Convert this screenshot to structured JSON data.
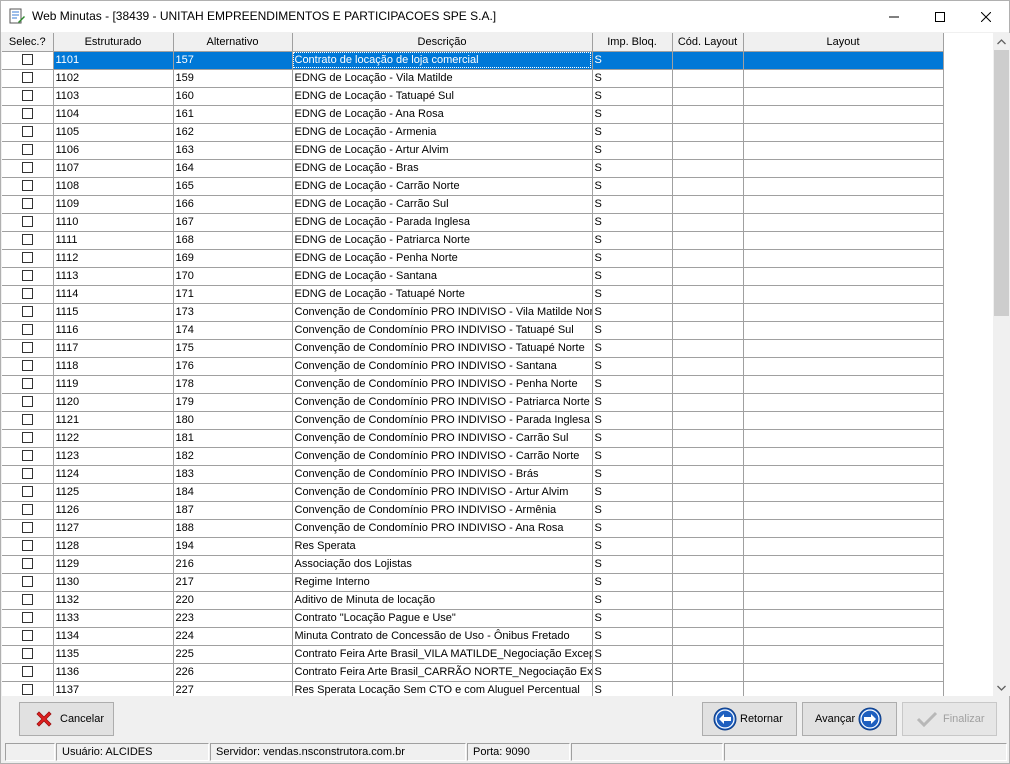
{
  "window": {
    "title": "Web Minutas - [38439 - UNITAH EMPREENDIMENTOS E PARTICIPACOES SPE S.A.]"
  },
  "grid": {
    "columns": [
      "Selec.?",
      "Estruturado",
      "Alternativo",
      "Descrição",
      "Imp. Bloq.",
      "Cód. Layout",
      "Layout"
    ],
    "rows": [
      {
        "estruturado": "1101",
        "alternativo": "157",
        "descricao": "Contrato de locação de loja comercial",
        "imp_bloq": "S",
        "cod_layout": "",
        "layout": ""
      },
      {
        "estruturado": "1102",
        "alternativo": "159",
        "descricao": "EDNG de Locação - Vila Matilde",
        "imp_bloq": "S",
        "cod_layout": "",
        "layout": ""
      },
      {
        "estruturado": "1103",
        "alternativo": "160",
        "descricao": "EDNG de Locação - Tatuapé Sul",
        "imp_bloq": "S",
        "cod_layout": "",
        "layout": ""
      },
      {
        "estruturado": "1104",
        "alternativo": "161",
        "descricao": "EDNG de Locação - Ana Rosa",
        "imp_bloq": "S",
        "cod_layout": "",
        "layout": ""
      },
      {
        "estruturado": "1105",
        "alternativo": "162",
        "descricao": "EDNG de Locação - Armenia",
        "imp_bloq": "S",
        "cod_layout": "",
        "layout": ""
      },
      {
        "estruturado": "1106",
        "alternativo": "163",
        "descricao": "EDNG de Locação - Artur Alvim",
        "imp_bloq": "S",
        "cod_layout": "",
        "layout": ""
      },
      {
        "estruturado": "1107",
        "alternativo": "164",
        "descricao": "EDNG de Locação - Bras",
        "imp_bloq": "S",
        "cod_layout": "",
        "layout": ""
      },
      {
        "estruturado": "1108",
        "alternativo": "165",
        "descricao": "EDNG de Locação - Carrão Norte",
        "imp_bloq": "S",
        "cod_layout": "",
        "layout": ""
      },
      {
        "estruturado": "1109",
        "alternativo": "166",
        "descricao": "EDNG de Locação - Carrão Sul",
        "imp_bloq": "S",
        "cod_layout": "",
        "layout": ""
      },
      {
        "estruturado": "1110",
        "alternativo": "167",
        "descricao": "EDNG de Locação - Parada Inglesa",
        "imp_bloq": "S",
        "cod_layout": "",
        "layout": ""
      },
      {
        "estruturado": "1111",
        "alternativo": "168",
        "descricao": "EDNG de Locação - Patriarca Norte",
        "imp_bloq": "S",
        "cod_layout": "",
        "layout": ""
      },
      {
        "estruturado": "1112",
        "alternativo": "169",
        "descricao": "EDNG de Locação - Penha Norte",
        "imp_bloq": "S",
        "cod_layout": "",
        "layout": ""
      },
      {
        "estruturado": "1113",
        "alternativo": "170",
        "descricao": "EDNG de Locação - Santana",
        "imp_bloq": "S",
        "cod_layout": "",
        "layout": ""
      },
      {
        "estruturado": "1114",
        "alternativo": "171",
        "descricao": "EDNG de Locação - Tatuapé Norte",
        "imp_bloq": "S",
        "cod_layout": "",
        "layout": ""
      },
      {
        "estruturado": "1115",
        "alternativo": "173",
        "descricao": "Convenção de Condomínio PRO INDIVISO - Vila Matilde Norte",
        "imp_bloq": "S",
        "cod_layout": "",
        "layout": ""
      },
      {
        "estruturado": "1116",
        "alternativo": "174",
        "descricao": "Convenção de Condomínio PRO INDIVISO - Tatuapé Sul",
        "imp_bloq": "S",
        "cod_layout": "",
        "layout": ""
      },
      {
        "estruturado": "1117",
        "alternativo": "175",
        "descricao": "Convenção de Condomínio PRO INDIVISO - Tatuapé Norte",
        "imp_bloq": "S",
        "cod_layout": "",
        "layout": ""
      },
      {
        "estruturado": "1118",
        "alternativo": "176",
        "descricao": "Convenção de Condomínio PRO INDIVISO - Santana",
        "imp_bloq": "S",
        "cod_layout": "",
        "layout": ""
      },
      {
        "estruturado": "1119",
        "alternativo": "178",
        "descricao": "Convenção de Condomínio PRO INDIVISO - Penha Norte",
        "imp_bloq": "S",
        "cod_layout": "",
        "layout": ""
      },
      {
        "estruturado": "1120",
        "alternativo": "179",
        "descricao": "Convenção de Condomínio PRO INDIVISO - Patriarca Norte",
        "imp_bloq": "S",
        "cod_layout": "",
        "layout": ""
      },
      {
        "estruturado": "1121",
        "alternativo": "180",
        "descricao": "Convenção de Condomínio PRO INDIVISO - Parada Inglesa",
        "imp_bloq": "S",
        "cod_layout": "",
        "layout": ""
      },
      {
        "estruturado": "1122",
        "alternativo": "181",
        "descricao": "Convenção de Condomínio PRO INDIVISO - Carrão Sul",
        "imp_bloq": "S",
        "cod_layout": "",
        "layout": ""
      },
      {
        "estruturado": "1123",
        "alternativo": "182",
        "descricao": "Convenção de Condomínio PRO INDIVISO - Carrão Norte",
        "imp_bloq": "S",
        "cod_layout": "",
        "layout": ""
      },
      {
        "estruturado": "1124",
        "alternativo": "183",
        "descricao": "Convenção de Condomínio PRO INDIVISO - Brás",
        "imp_bloq": "S",
        "cod_layout": "",
        "layout": ""
      },
      {
        "estruturado": "1125",
        "alternativo": "184",
        "descricao": "Convenção de Condomínio PRO INDIVISO - Artur Alvim",
        "imp_bloq": "S",
        "cod_layout": "",
        "layout": ""
      },
      {
        "estruturado": "1126",
        "alternativo": "187",
        "descricao": "Convenção de Condomínio PRO INDIVISO - Armênia",
        "imp_bloq": "S",
        "cod_layout": "",
        "layout": ""
      },
      {
        "estruturado": "1127",
        "alternativo": "188",
        "descricao": "Convenção de Condomínio PRO INDIVISO - Ana Rosa",
        "imp_bloq": "S",
        "cod_layout": "",
        "layout": ""
      },
      {
        "estruturado": "1128",
        "alternativo": "194",
        "descricao": "Res Sperata",
        "imp_bloq": "S",
        "cod_layout": "",
        "layout": ""
      },
      {
        "estruturado": "1129",
        "alternativo": "216",
        "descricao": "Associação dos Lojistas",
        "imp_bloq": "S",
        "cod_layout": "",
        "layout": ""
      },
      {
        "estruturado": "1130",
        "alternativo": "217",
        "descricao": "Regime Interno",
        "imp_bloq": "S",
        "cod_layout": "",
        "layout": ""
      },
      {
        "estruturado": "1132",
        "alternativo": "220",
        "descricao": "Aditivo de Minuta de locação",
        "imp_bloq": "S",
        "cod_layout": "",
        "layout": ""
      },
      {
        "estruturado": "1133",
        "alternativo": "223",
        "descricao": "Contrato \"Locação Pague e Use\"",
        "imp_bloq": "S",
        "cod_layout": "",
        "layout": ""
      },
      {
        "estruturado": "1134",
        "alternativo": "224",
        "descricao": "Minuta Contrato de Concessão de Uso - Ônibus Fretado",
        "imp_bloq": "S",
        "cod_layout": "",
        "layout": ""
      },
      {
        "estruturado": "1135",
        "alternativo": "225",
        "descricao": "Contrato Feira Arte Brasil_VILA MATILDE_Negociação Excepcional",
        "imp_bloq": "S",
        "cod_layout": "",
        "layout": ""
      },
      {
        "estruturado": "1136",
        "alternativo": "226",
        "descricao": "Contrato Feira Arte Brasil_CARRÃO NORTE_Negociação Excepcional",
        "imp_bloq": "S",
        "cod_layout": "",
        "layout": ""
      },
      {
        "estruturado": "1137",
        "alternativo": "227",
        "descricao": "Res Sperata Locação Sem CTO e com Aluguel Percentual",
        "imp_bloq": "S",
        "cod_layout": "",
        "layout": ""
      }
    ]
  },
  "buttons": {
    "cancel": "Cancelar",
    "back": "Retornar",
    "next": "Avançar",
    "finish": "Finalizar"
  },
  "statusbar": {
    "panel1": "",
    "user": "Usuário: ALCIDES",
    "server": "Servidor: vendas.nsconstrutora.com.br",
    "port": "Porta: 9090",
    "panel5": "",
    "panel6": ""
  },
  "colors": {
    "selection": "#0078d7",
    "cancel_icon": "#e02020",
    "nav_icon": "#1e5fbf"
  },
  "icons": [
    "app-icon",
    "minimize-icon",
    "maximize-icon",
    "close-icon",
    "cancel-x-icon",
    "arrow-left-icon",
    "arrow-right-icon",
    "check-icon",
    "scroll-up-icon",
    "scroll-down-icon"
  ]
}
